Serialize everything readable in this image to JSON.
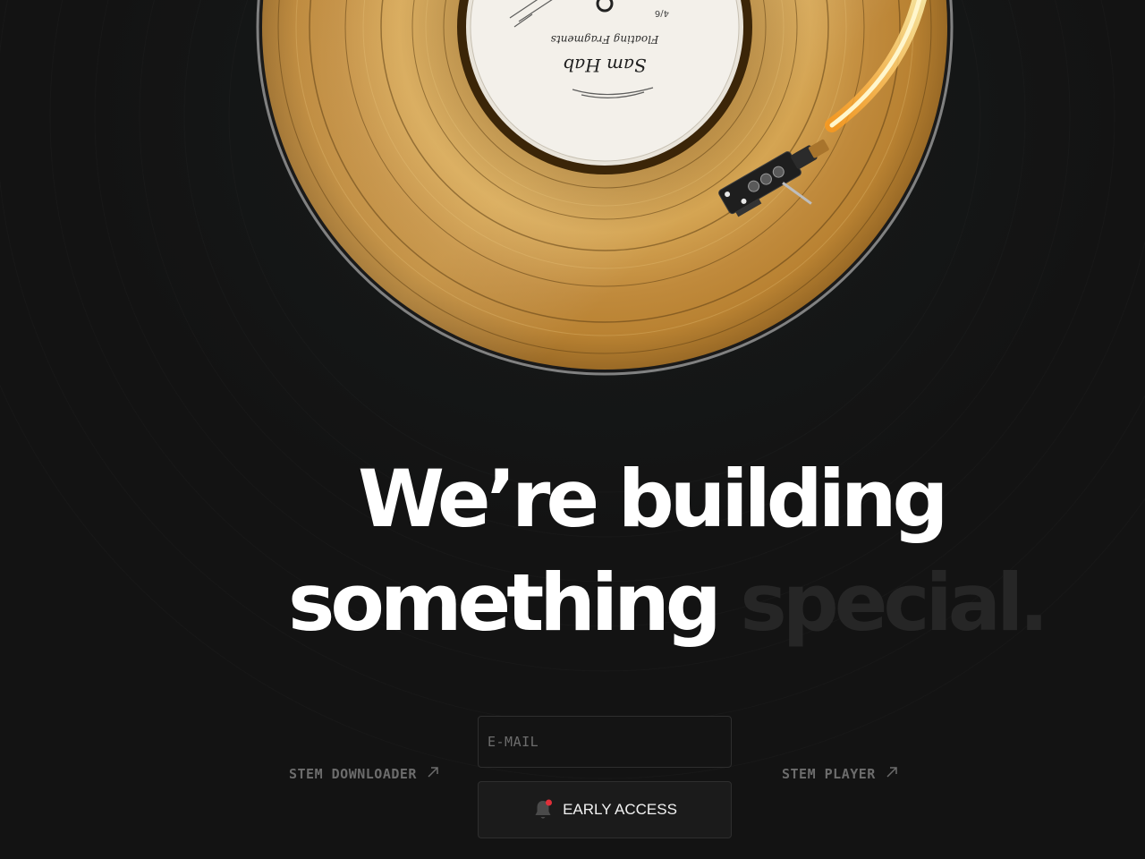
{
  "record": {
    "label_title": "Floating Fragments",
    "label_signature": "Sam Hab",
    "label_code": "4/6"
  },
  "headline": {
    "line1": "We’re building",
    "line2_bright": "something",
    "line2_dim": "special."
  },
  "links": {
    "left": "STEM DOWNLOADER",
    "right": "STEM PLAYER"
  },
  "form": {
    "email_placeholder": "E-MAIL",
    "email_value": "",
    "button_label": "EARLY ACCESS"
  },
  "icons": {
    "link_arrow": "arrow-up-right-icon",
    "bell": "bell-icon",
    "accent": "#e0303a"
  },
  "colors": {
    "background": "#131313",
    "gold": "#c99a45",
    "text": "#ffffff",
    "muted": "#6c6c6c"
  }
}
